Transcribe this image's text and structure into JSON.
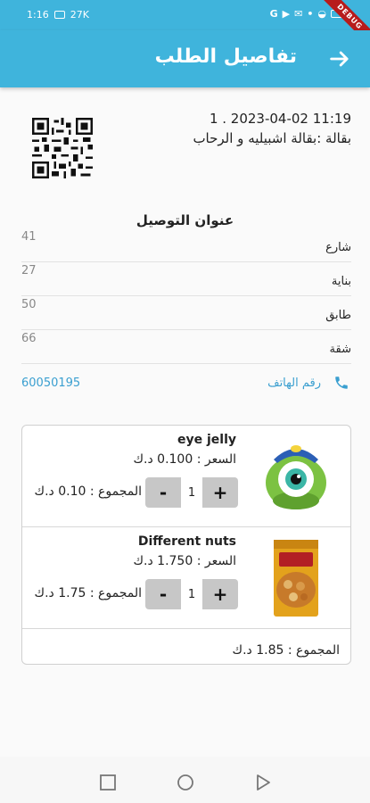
{
  "status_bar": {
    "time": "1:16",
    "network": "27K"
  },
  "debug_banner": "DEBUG",
  "app_bar": {
    "title": "تفاصيل الطلب",
    "back_icon": "arrow-right-icon"
  },
  "order": {
    "line1": "11:19 2023-04-02 . 1",
    "line2": "بقالة  :بقالة اشبيليه و الرحاب"
  },
  "address": {
    "title": "عنوان التوصيل",
    "rows": [
      {
        "label": "شارع",
        "value": "41"
      },
      {
        "label": "بناية",
        "value": "27"
      },
      {
        "label": "طابق",
        "value": "50"
      },
      {
        "label": "شقة",
        "value": "66"
      }
    ]
  },
  "phone": {
    "label": "رقم الهاتف",
    "value": "60050195",
    "icon": "phone-icon"
  },
  "items": [
    {
      "name": "eye jelly",
      "price": "السعر : 0.100 د.ك",
      "qty": "1",
      "minus": "-",
      "plus": "+",
      "subtotal": "المجموع : 0.10 د.ك"
    },
    {
      "name": "Different nuts",
      "price": "السعر : 1.750 د.ك",
      "qty": "1",
      "minus": "-",
      "plus": "+",
      "subtotal": "المجموع : 1.75 د.ك"
    }
  ],
  "total": "المجموع : 1.85 د.ك",
  "colors": {
    "primary": "#3fb4dc",
    "link": "#3a9fd0",
    "stepper": "#c7c7c7"
  }
}
